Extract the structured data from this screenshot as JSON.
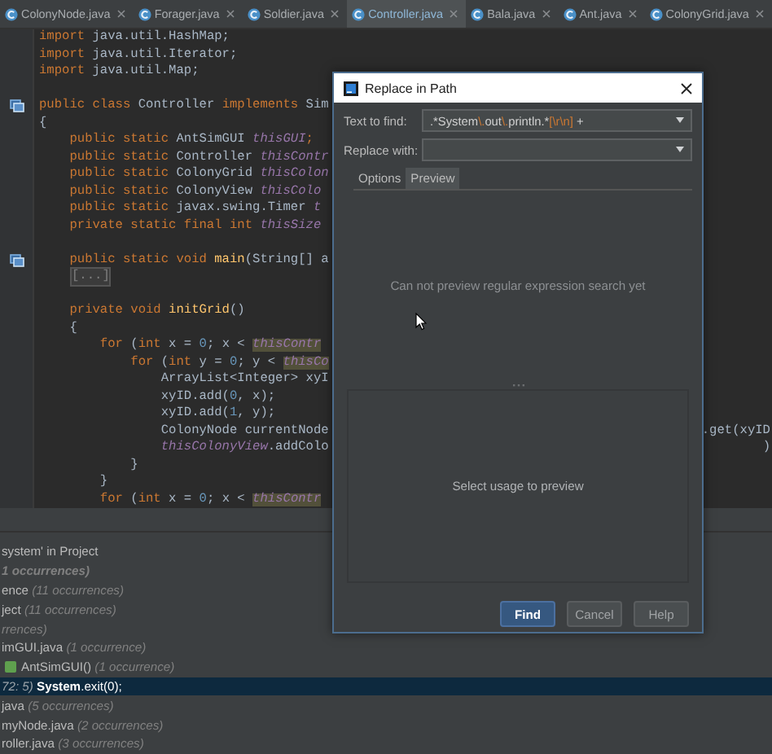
{
  "tabs": [
    {
      "label": "ColonyNode.java",
      "selected": false
    },
    {
      "label": "Forager.java",
      "selected": false
    },
    {
      "label": "Soldier.java",
      "selected": false
    },
    {
      "label": "Controller.java",
      "selected": true
    },
    {
      "label": "Bala.java",
      "selected": false
    },
    {
      "label": "Ant.java",
      "selected": false
    },
    {
      "label": "ColonyGrid.java",
      "selected": false
    }
  ],
  "editor": {
    "lines": [
      {
        "kind": "code",
        "tokens": [
          {
            "text": "import",
            "kind": "keyword"
          },
          {
            "text": " java.util.HashMap;",
            "kind": "plain"
          }
        ]
      },
      {
        "kind": "code",
        "tokens": [
          {
            "text": "import",
            "kind": "keyword"
          },
          {
            "text": " java.util.Iterator;",
            "kind": "plain"
          }
        ]
      },
      {
        "kind": "code",
        "tokens": [
          {
            "text": "import",
            "kind": "keyword"
          },
          {
            "text": " java.util.Map;",
            "kind": "plain"
          }
        ]
      },
      {
        "kind": "blank"
      },
      {
        "kind": "code",
        "gutter_marker": true,
        "tokens": [
          {
            "text": "public class",
            "kind": "keyword"
          },
          {
            "text": " Controller ",
            "kind": "plain"
          },
          {
            "text": "implements",
            "kind": "keyword"
          },
          {
            "text": " Sim",
            "kind": "plain"
          }
        ]
      },
      {
        "kind": "code",
        "tokens": [
          {
            "text": "{",
            "kind": "plain"
          }
        ]
      },
      {
        "kind": "code",
        "tokens": [
          {
            "text": "    public static",
            "kind": "keyword"
          },
          {
            "text": " AntSimGUI ",
            "kind": "plain"
          },
          {
            "text": "thisGUI",
            "kind": "field"
          },
          {
            "text": ";",
            "kind": "keyword"
          }
        ]
      },
      {
        "kind": "code",
        "tokens": [
          {
            "text": "    public static",
            "kind": "keyword"
          },
          {
            "text": " Controller ",
            "kind": "plain"
          },
          {
            "text": "thisContr",
            "kind": "field"
          }
        ]
      },
      {
        "kind": "code",
        "tokens": [
          {
            "text": "    public static",
            "kind": "keyword"
          },
          {
            "text": " ColonyGrid ",
            "kind": "plain"
          },
          {
            "text": "thisColon",
            "kind": "field"
          }
        ]
      },
      {
        "kind": "code",
        "tokens": [
          {
            "text": "    public static",
            "kind": "keyword"
          },
          {
            "text": " ColonyView ",
            "kind": "plain"
          },
          {
            "text": "thisColo",
            "kind": "field"
          }
        ]
      },
      {
        "kind": "code",
        "tokens": [
          {
            "text": "    public static",
            "kind": "keyword"
          },
          {
            "text": " javax.swing.Timer ",
            "kind": "plain"
          },
          {
            "text": "t",
            "kind": "field"
          }
        ]
      },
      {
        "kind": "code",
        "tokens": [
          {
            "text": "    private static final int ",
            "kind": "keyword"
          },
          {
            "text": "thisSize",
            "kind": "field"
          }
        ]
      },
      {
        "kind": "blank"
      },
      {
        "kind": "code",
        "gutter_marker": true,
        "tokens": [
          {
            "text": "    public static void ",
            "kind": "keyword"
          },
          {
            "text": "main",
            "kind": "method"
          },
          {
            "text": "(String[] a",
            "kind": "plain"
          }
        ]
      },
      {
        "kind": "fold",
        "text": "[...]"
      },
      {
        "kind": "blank"
      },
      {
        "kind": "code",
        "tokens": [
          {
            "text": "    private void ",
            "kind": "keyword"
          },
          {
            "text": "initGrid",
            "kind": "method"
          },
          {
            "text": "()",
            "kind": "plain"
          }
        ]
      },
      {
        "kind": "code",
        "tokens": [
          {
            "text": "    {",
            "kind": "plain"
          }
        ]
      },
      {
        "kind": "code",
        "tokens": [
          {
            "text": "        for",
            "kind": "keyword"
          },
          {
            "text": " (",
            "kind": "plain"
          },
          {
            "text": "int",
            "kind": "keyword"
          },
          {
            "text": " x = ",
            "kind": "plain"
          },
          {
            "text": "0",
            "kind": "number"
          },
          {
            "text": "; x < ",
            "kind": "plain"
          },
          {
            "text": "thisContr",
            "kind": "match"
          }
        ]
      },
      {
        "kind": "code",
        "tokens": [
          {
            "text": "            for",
            "kind": "keyword"
          },
          {
            "text": " (",
            "kind": "plain"
          },
          {
            "text": "int",
            "kind": "keyword"
          },
          {
            "text": " y = ",
            "kind": "plain"
          },
          {
            "text": "0",
            "kind": "number"
          },
          {
            "text": "; y < ",
            "kind": "plain"
          },
          {
            "text": "thisCo",
            "kind": "match"
          }
        ]
      },
      {
        "kind": "code",
        "tokens": [
          {
            "text": "                ArrayList<Integer> xyI",
            "kind": "plain"
          }
        ]
      },
      {
        "kind": "code",
        "tokens": [
          {
            "text": "                xyID.add(",
            "kind": "plain"
          },
          {
            "text": "0",
            "kind": "number"
          },
          {
            "text": ", x);",
            "kind": "plain"
          }
        ]
      },
      {
        "kind": "code",
        "tokens": [
          {
            "text": "                xyID.add(",
            "kind": "plain"
          },
          {
            "text": "1",
            "kind": "number"
          },
          {
            "text": ", y);",
            "kind": "plain"
          }
        ]
      },
      {
        "kind": "code",
        "tokens": [
          {
            "text": "                ColonyNode currentNode",
            "kind": "plain"
          }
        ],
        "fragment": ".get(xyID"
      },
      {
        "kind": "code",
        "tokens": [
          {
            "text": "                thisColonyView",
            "kind": "field"
          },
          {
            "text": ".addColo",
            "kind": "plain"
          }
        ],
        "fragment": ")"
      },
      {
        "kind": "code",
        "tokens": [
          {
            "text": "            }",
            "kind": "plain"
          }
        ]
      },
      {
        "kind": "code",
        "tokens": [
          {
            "text": "        }",
            "kind": "plain"
          }
        ]
      },
      {
        "kind": "code",
        "tokens": [
          {
            "text": "        for",
            "kind": "keyword"
          },
          {
            "text": " (",
            "kind": "plain"
          },
          {
            "text": "int",
            "kind": "keyword"
          },
          {
            "text": " x = ",
            "kind": "plain"
          },
          {
            "text": "0",
            "kind": "number"
          },
          {
            "text": "; x < ",
            "kind": "plain"
          },
          {
            "text": "thisContr",
            "kind": "match"
          }
        ]
      }
    ]
  },
  "results": [
    {
      "kind": "header",
      "name": "system' in Project",
      "selected": false
    },
    {
      "kind": "summary",
      "count": "1 occurrences)",
      "selected": false
    },
    {
      "kind": "group",
      "name": "ence",
      "count": "(11 occurrences)",
      "selected": false
    },
    {
      "kind": "group",
      "name": "ject",
      "count": "(11 occurrences)",
      "selected": false
    },
    {
      "kind": "group",
      "count": "rrences)",
      "selected": false
    },
    {
      "kind": "file",
      "name": "imGUI.java",
      "count": "(1 occurrence)",
      "selected": false
    },
    {
      "kind": "method",
      "name": "AntSimGUI()",
      "count": "(1 occurrence)",
      "selected": false
    },
    {
      "kind": "usage",
      "location": "72: 5)",
      "name": "**System**.exit(0);",
      "selected": true
    },
    {
      "kind": "file",
      "name": "java",
      "count": "(5 occurrences)",
      "selected": false
    },
    {
      "kind": "file",
      "name": "myNode.java",
      "count": "(2 occurrences)",
      "selected": false
    },
    {
      "kind": "file",
      "name": "roller.java",
      "count": "(3 occurrences)",
      "selected": false
    }
  ],
  "dialog": {
    "title": "Replace in Path",
    "find_label": "Text to find:",
    "find_value": [
      {
        "text": ".*System",
        "kind": "plain"
      },
      {
        "text": "\\.",
        "kind": "escape"
      },
      {
        "text": "out",
        "kind": "plain"
      },
      {
        "text": "\\.",
        "kind": "escape"
      },
      {
        "text": "println.*",
        "kind": "plain"
      },
      {
        "text": "[\\r\\n]",
        "kind": "escape"
      },
      {
        "text": " +",
        "kind": "plain"
      }
    ],
    "replace_label": "Replace with:",
    "tabs": [
      {
        "label": "Options",
        "selected": false
      },
      {
        "label": "Preview",
        "selected": true
      }
    ],
    "preview_message": "Can not preview regular expression search yet",
    "usage_message": "Select usage to preview",
    "buttons": [
      {
        "label": "Find",
        "primary": true
      },
      {
        "label": "Cancel",
        "primary": false
      },
      {
        "label": "Help",
        "primary": false
      }
    ]
  }
}
